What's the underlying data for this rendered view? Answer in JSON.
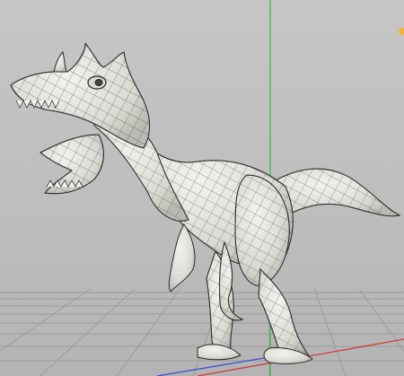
{
  "viewport": {
    "label": "",
    "model": "dinosaur-wireframe-mesh"
  },
  "colors": {
    "background": "#bdbdbd",
    "grid": "#9a9a9a",
    "y_axis": "#2fb84a",
    "x_axis": "#d23a3a",
    "z_axis": "#3a4fd2",
    "light": "#f3b23a",
    "mesh_fill": "#e4e6df",
    "mesh_wire": "#1e1e1e"
  },
  "icons": {
    "light": "light-icon"
  }
}
